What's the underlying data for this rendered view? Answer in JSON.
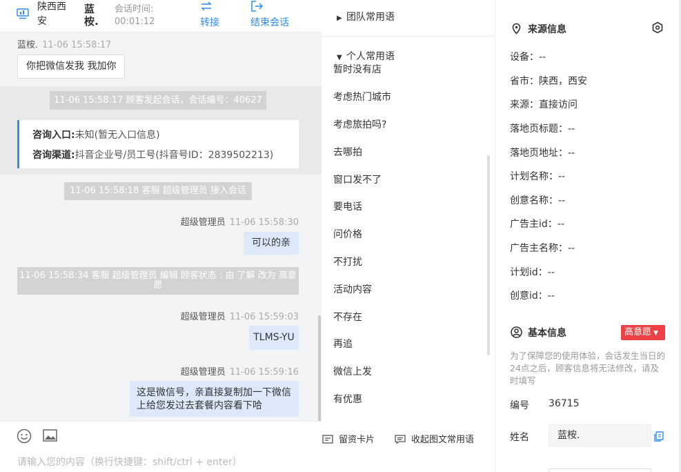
{
  "chat_header": {
    "location": "陕西西安",
    "customer_name": "蓝桉.",
    "session_time_label": "会话时间:",
    "session_time_value": "00:01:12",
    "transfer_label": "转接",
    "end_session_label": "结束会话"
  },
  "messages": {
    "m1_sender": "蓝桉.",
    "m1_time": "11-06 15:58:17",
    "m1_text": "你把微信发我 我加你",
    "sys1": "11-06 15:58:17 顾客发起会话，会话编号：40627",
    "entry_label": "咨询入口:",
    "entry_value": "未知(暂无入口信息)",
    "channel_label": "咨询渠道:",
    "channel_value": "抖音企业号/员工号(抖音号ID：2839502213)",
    "sys2": "11-06 15:58:18 客服 超级管理员 接入会话",
    "m2_sender": "超级管理员",
    "m2_time": "11-06 15:58:30",
    "m2_text": "可以的亲",
    "sys3": "11-06 15:58:34 客服 超级管理员 编辑 顾客状态 : 由 了解 改为 高意愿",
    "m3_sender": "超级管理员",
    "m3_time": "11-06 15:59:03",
    "m3_text": "TLMS-YU",
    "m4_sender": "超级管理员",
    "m4_time": "11-06 15:59:16",
    "m4_text": "这是微信号，亲直接复制加一下微信上给您发过去套餐内容看下哈"
  },
  "input": {
    "placeholder": "请输入您的内容（换行快捷键：shift/ctrl + enter）"
  },
  "phrases": {
    "team_group": "团队常用语",
    "personal_group": "个人常用语",
    "items": [
      "暂时没有店",
      "考虑热门城市",
      "考虑旅拍吗?",
      "去哪拍",
      "窗口发不了",
      "要电话",
      "问价格",
      "不打扰",
      "活动内容",
      "不存在",
      "再追",
      "微信上发",
      "有优惠"
    ],
    "card_button": "留资卡片",
    "collapse_button": "收起图文常用语"
  },
  "source_info": {
    "title": "来源信息",
    "rows": [
      "设备：--",
      "省市：陕西，西安",
      "来源：直接访问",
      "落地页标题：--",
      "落地页地址：--",
      "计划名称：--",
      "创意名称：--",
      "广告主id：--",
      "广告主名称：--",
      "计划id：--",
      "创意id：--"
    ]
  },
  "basic_info": {
    "title": "基本信息",
    "intent_badge": "高意愿",
    "notice": "为了保障您的使用体验，会话发生当日的24点之后，顾客信息将无法修改，请及时填写",
    "id_label": "编号",
    "id_value": "36715",
    "name_label": "姓名",
    "name_value": "蓝桉."
  },
  "colors": {
    "accent": "#2d8cf0",
    "intent_badge": "#ed4145",
    "agent_bubble": "#dde9fb",
    "chat_background": "#f3f4f6"
  },
  "icons": {
    "header": "monitor-icon",
    "transfer": "swap-arrows-icon",
    "end": "logout-icon",
    "emoji": "smiley-icon",
    "image": "image-icon",
    "card": "card-icon",
    "collapse": "chat-text-icon",
    "source": "location-pin-icon",
    "settings": "hexagon-settings-icon",
    "basic": "user-circle-icon",
    "copy": "copy-icon"
  }
}
